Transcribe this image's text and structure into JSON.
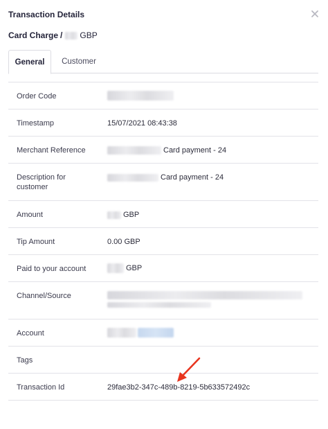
{
  "modal": {
    "title": "Transaction Details",
    "subtitle_prefix": "Card Charge",
    "subtitle_sep": "/",
    "subtitle_currency": "GBP"
  },
  "tabs": [
    {
      "label": "General",
      "active": true
    },
    {
      "label": "Customer",
      "active": false
    }
  ],
  "details": {
    "order_code": {
      "label": "Order Code"
    },
    "timestamp": {
      "label": "Timestamp",
      "value": "15/07/2021 08:43:38"
    },
    "merchant_reference": {
      "label": "Merchant Reference",
      "suffix": "Card payment - 24"
    },
    "description": {
      "label": "Description for customer",
      "suffix": "Card payment - 24"
    },
    "amount": {
      "label": "Amount",
      "suffix": "GBP"
    },
    "tip_amount": {
      "label": "Tip Amount",
      "value": "0.00 GBP"
    },
    "paid_to_account": {
      "label": "Paid to your account",
      "suffix": "GBP"
    },
    "channel_source": {
      "label": "Channel/Source"
    },
    "account": {
      "label": "Account"
    },
    "tags": {
      "label": "Tags"
    },
    "transaction_id": {
      "label": "Transaction Id",
      "value": "29fae3b2-347c-489b-8219-5b633572492c"
    }
  },
  "icons": {
    "close": "close-icon",
    "annotation": "red-arrow-annotation"
  },
  "colors": {
    "annotation_arrow": "#e8351f",
    "account_link_blur": "#c6d8ef"
  }
}
